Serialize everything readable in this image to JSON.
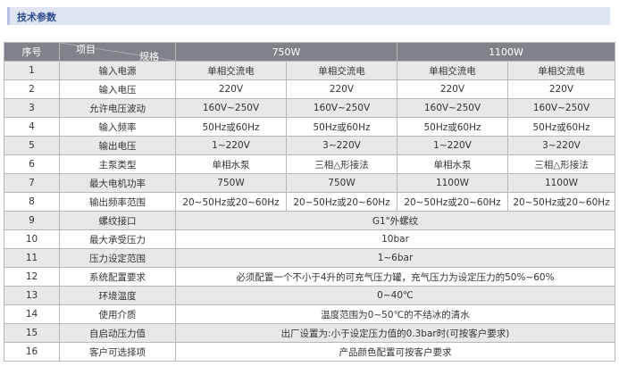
{
  "section_title": "技术参数",
  "header": {
    "seq": "序号",
    "spec_label": "规格",
    "item_label": "项目",
    "model_a": "750W",
    "model_b": "1100W"
  },
  "rows": [
    {
      "no": "1",
      "item": "输入电源",
      "cells": [
        "单相交流电",
        "单相交流电",
        "单相交流电",
        "单相交流电"
      ]
    },
    {
      "no": "2",
      "item": "输入电压",
      "cells": [
        "220V",
        "220V",
        "220V",
        "220V"
      ]
    },
    {
      "no": "3",
      "item": "允许电压波动",
      "cells": [
        "160V~250V",
        "160V~250V",
        "160V~250V",
        "160V~250V"
      ]
    },
    {
      "no": "4",
      "item": "输入频率",
      "cells": [
        "50Hz或60Hz",
        "50Hz或60Hz",
        "50Hz或60Hz",
        "50Hz或60Hz"
      ]
    },
    {
      "no": "5",
      "item": "输出电压",
      "cells": [
        "1~220V",
        "3~220V",
        "1~220V",
        "3~220V"
      ]
    },
    {
      "no": "6",
      "item": "主泵类型",
      "cells": [
        "单相水泵",
        "三相△形接法",
        "单相水泵",
        "三相△形接法"
      ]
    },
    {
      "no": "7",
      "item": "最大电机功率",
      "cells": [
        "750W",
        "750W",
        "1100W",
        "1100W"
      ]
    },
    {
      "no": "8",
      "item": "输出频率范围",
      "cells": [
        "20~50Hz或20~60Hz",
        "20~50Hz或20~60Hz",
        "20~50Hz或20~60Hz",
        "20~50Hz或20~60Hz"
      ]
    },
    {
      "no": "9",
      "item": "螺纹接口",
      "merged": "G1\"外螺纹"
    },
    {
      "no": "10",
      "item": "最大承受压力",
      "merged": "10bar"
    },
    {
      "no": "11",
      "item": "压力设定范围",
      "merged": "1~6bar"
    },
    {
      "no": "12",
      "item": "系统配置要求",
      "merged": "必须配置一个不小于4升的可充气压力罐，充气压力为设定压力的50%~60%"
    },
    {
      "no": "13",
      "item": "环境温度",
      "merged": "0~40℃"
    },
    {
      "no": "14",
      "item": "使用介质",
      "merged": "温度范围为0~50℃的不结冰的清水"
    },
    {
      "no": "15",
      "item": "自启动压力值",
      "merged": "出厂设置为:小于设定压力值的0.3bar时(可按客户要求)"
    },
    {
      "no": "16",
      "item": "客户可选择项",
      "merged": "产品颜色配置可按客户要求"
    }
  ]
}
